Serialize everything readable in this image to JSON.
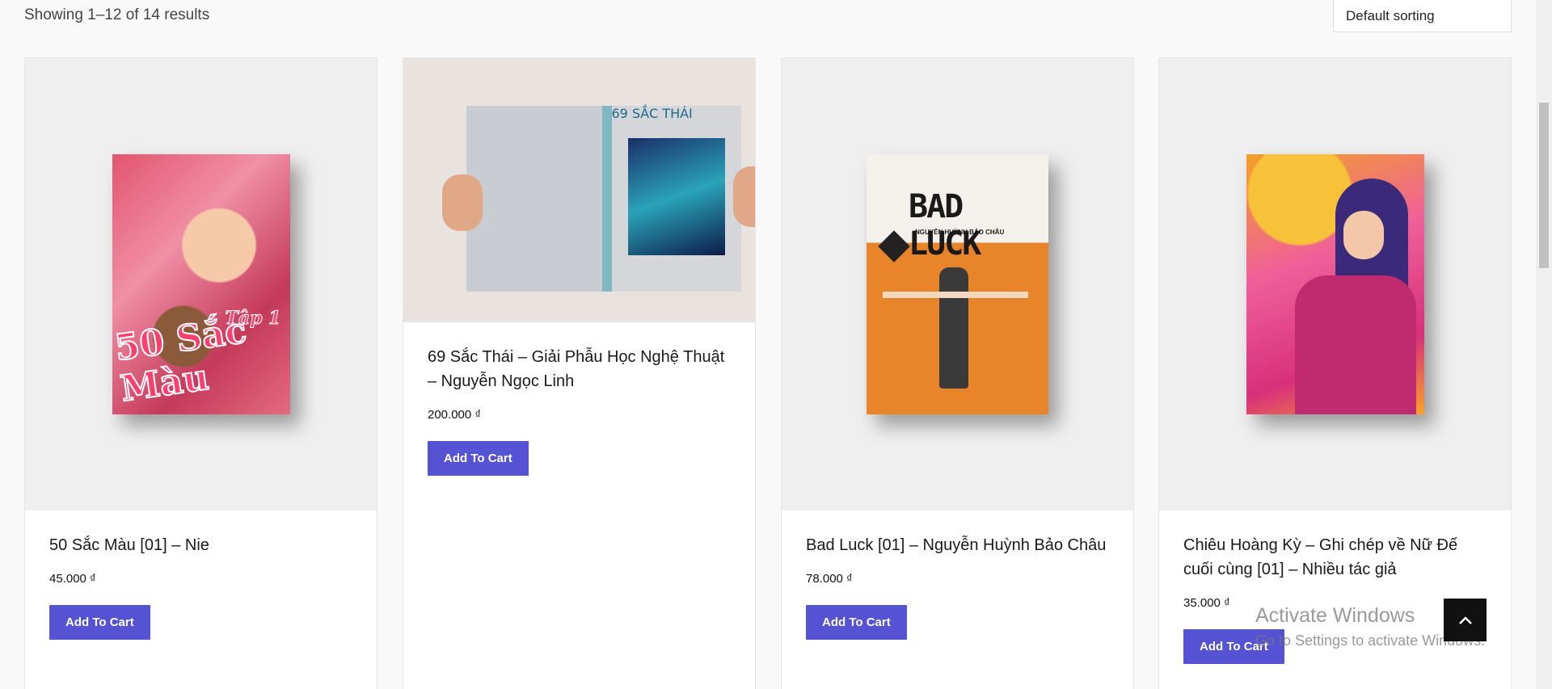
{
  "toolbar": {
    "result_count": "Showing 1–12 of 14 results",
    "sort_selected": "Default sorting"
  },
  "products": [
    {
      "title": "50 Sắc Màu [01] – Nie",
      "price": "45.000 ₫",
      "button": "Add To Cart",
      "cover_text": "50 Sắc Màu",
      "cover_sub": "Tập 1",
      "cover_color": "#d8446a"
    },
    {
      "title": "69 Sắc Thái – Giải Phẫu Học Nghệ Thuật – Nguyễn Ngọc Linh",
      "price": "200.000 ₫",
      "button": "Add To Cart",
      "cover_text": "69 SẮC THÁI",
      "cover_color": "#1e3a6e"
    },
    {
      "title": "Bad Luck [01] – Nguyễn Huỳnh Bảo Châu",
      "price": "78.000 ₫",
      "button": "Add To Cart",
      "cover_text": "BAD LUCK",
      "cover_sub": "NGUYỄN HUỲNH BẢO CHÂU",
      "cover_color": "#e8842a"
    },
    {
      "title": "Chiêu Hoàng Kỳ – Ghi chép về Nữ Đế cuối cùng [01] – Nhiều tác giả",
      "price": "35.000 ₫",
      "button": "Add To Cart",
      "cover_color": "#e04a8c"
    }
  ],
  "watermark": {
    "line1": "Activate Windows",
    "line2": "Go to Settings to activate Windows."
  },
  "icons": {
    "back_to_top": "chevron-up-icon",
    "sort": "chevron-down-icon"
  }
}
